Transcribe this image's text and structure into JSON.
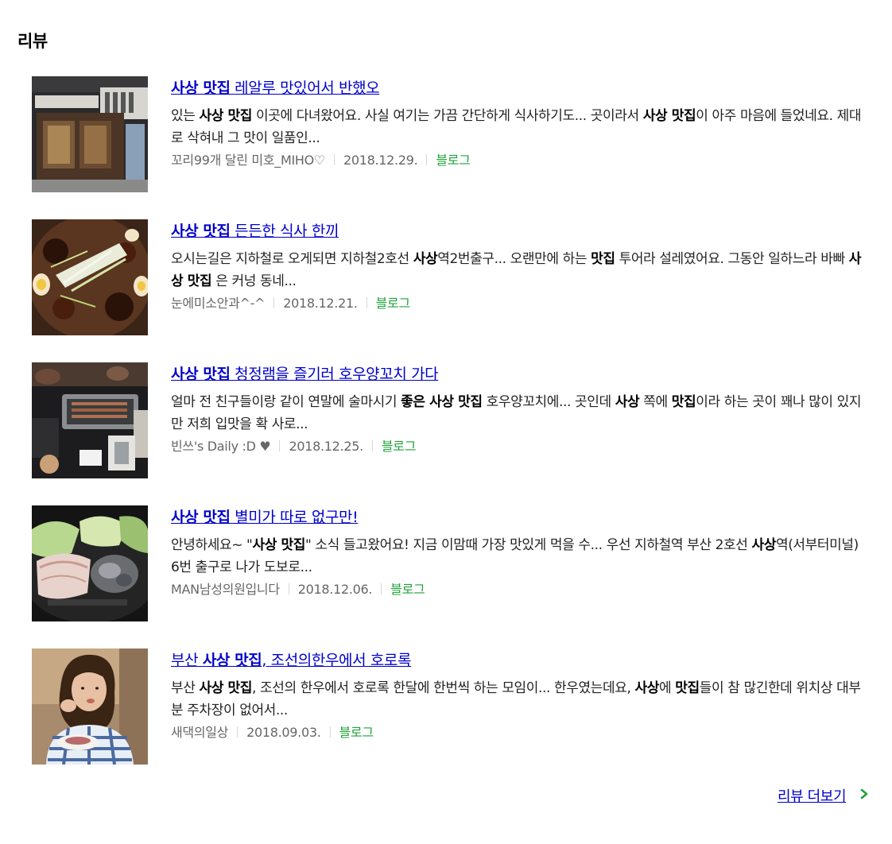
{
  "section": {
    "title": "리뷰"
  },
  "reviews": [
    {
      "title_pre": "",
      "title_keyword": "사상 맛집",
      "title_rest": " 레알루 맛있어서 반했오",
      "desc": [
        {
          "t": "있는 ",
          "b": false
        },
        {
          "t": "사상 맛집",
          "b": true
        },
        {
          "t": " 이곳에 다녀왔어요. 사실 여기는 가끔 간단하게 식사하기도... 곳이라서 ",
          "b": false
        },
        {
          "t": "사상 맛집",
          "b": true
        },
        {
          "t": "이 아주 마음에 들었네요. 제대로 삭혀내 그 맛이 일품인...",
          "b": false
        }
      ],
      "author": "꼬리99개 달린 미호_MIHO♡",
      "date": "2018.12.29.",
      "source": "블로그",
      "thumbnail": "restaurant-storefront"
    },
    {
      "title_pre": "",
      "title_keyword": "사상 맛집",
      "title_rest": " 든든한 식사 한끼",
      "desc": [
        {
          "t": "오시는길은 지하철로 오게되면 지하철2호선 ",
          "b": false
        },
        {
          "t": "사상",
          "b": true
        },
        {
          "t": "역2번출구... 오랜만에 하는 ",
          "b": false
        },
        {
          "t": "맛집",
          "b": true
        },
        {
          "t": " 투어라 설레였어요. 그동안 일하느라 바빠 ",
          "b": false
        },
        {
          "t": "사상 맛집",
          "b": true
        },
        {
          "t": " 은 커넝 동네...",
          "b": false
        }
      ],
      "author": "눈에미소안과^-^",
      "date": "2018.12.21.",
      "source": "블로그",
      "thumbnail": "braised-chicken-dish"
    },
    {
      "title_pre": "",
      "title_keyword": "사상 맛집",
      "title_rest": " 청정램을 즐기러 호우양꼬치 가다",
      "desc": [
        {
          "t": "얼마 전 친구들이랑 같이 연말에 술마시기 ",
          "b": false
        },
        {
          "t": "좋은 사상 맛집",
          "b": true
        },
        {
          "t": " 호우양꼬치에... 곳인데 ",
          "b": false
        },
        {
          "t": "사상",
          "b": true
        },
        {
          "t": " 쪽에 ",
          "b": false
        },
        {
          "t": "맛집",
          "b": true
        },
        {
          "t": "이라 하는 곳이 꽤나 많이 있지만 저희 입맛을 확 사로...",
          "b": false
        }
      ],
      "author": "빈쓰's Daily :D ♥",
      "date": "2018.12.25.",
      "source": "블로그",
      "thumbnail": "lamb-skewer-grill"
    },
    {
      "title_pre": "",
      "title_keyword": "사상 맛집",
      "title_rest": " 별미가 따로 없구만!",
      "desc": [
        {
          "t": "안녕하세요~ \"",
          "b": false
        },
        {
          "t": "사상 맛집",
          "b": true
        },
        {
          "t": "\" 소식 들고왔어요! 지금 이맘때 가장 맛있게 먹을 수... 우선 지하철역 부산 2호선 ",
          "b": false
        },
        {
          "t": "사상",
          "b": true
        },
        {
          "t": "역(서부터미널) 6번 출구로 나가 도보로...",
          "b": false
        }
      ],
      "author": "MAN남성의원입니다",
      "date": "2018.12.06.",
      "source": "블로그",
      "thumbnail": "boiled-pork-platter"
    },
    {
      "title_pre": "부산 ",
      "title_keyword": "사상 맛집",
      "title_rest": ", 조선의한우에서 호로록",
      "desc": [
        {
          "t": "부산 ",
          "b": false
        },
        {
          "t": "사상 맛집",
          "b": true
        },
        {
          "t": ", 조선의 한우에서 호로록 한달에 한번씩 하는 모임이... 한우였는데요, ",
          "b": false
        },
        {
          "t": "사상",
          "b": true
        },
        {
          "t": "에 ",
          "b": false
        },
        {
          "t": "맛집",
          "b": true
        },
        {
          "t": "들이 참 많긴한데 위치상 대부분 주차장이 없어서...",
          "b": false
        }
      ],
      "author": "새댁의일상",
      "date": "2018.09.03.",
      "source": "블로그",
      "thumbnail": "woman-eating"
    }
  ],
  "more": {
    "label": "리뷰 더보기"
  },
  "colors": {
    "link": "#0000cc",
    "source": "#21a33b",
    "meta": "#666666",
    "separator": "#d8d8d8"
  }
}
